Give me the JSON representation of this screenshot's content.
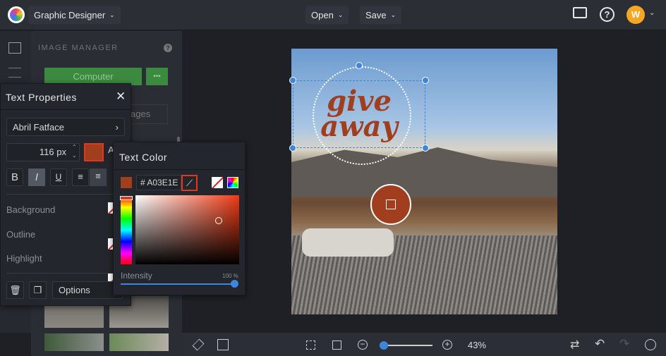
{
  "topbar": {
    "project": "Graphic Designer",
    "open": "Open",
    "save": "Save",
    "avatar": "W"
  },
  "panel": {
    "title": "IMAGE MANAGER",
    "computer": "Computer",
    "more": "•••",
    "images": "ages"
  },
  "text_props": {
    "title": "Text Properties",
    "font": "Abril Fatface",
    "size": "116 px",
    "bold": "B",
    "italic": "I",
    "underline": "U",
    "background": "Background",
    "outline": "Outline",
    "highlight": "Highlight",
    "options": "Options",
    "align_letter": "A"
  },
  "text_color": {
    "title": "Text Color",
    "hex": "# A03E1E",
    "intensity_label": "Intensity",
    "intensity_value": "100 %",
    "intensity": 100,
    "current_color": "#A03E1E"
  },
  "canvas": {
    "line1": "give",
    "line2": "away"
  },
  "bottombar": {
    "zoom": "43%",
    "zoom_level": 43
  }
}
